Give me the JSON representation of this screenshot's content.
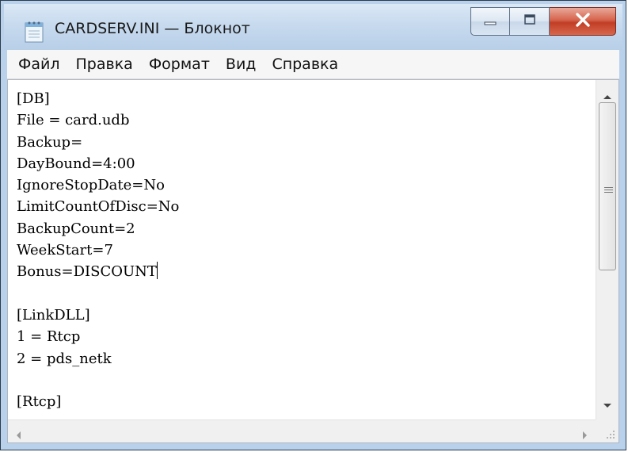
{
  "window": {
    "title": "CARDSERV.INI — Блокнот",
    "icon": "notepad-icon",
    "caption_buttons": [
      "minimize-icon",
      "maximize-icon",
      "close-icon"
    ]
  },
  "menu": {
    "items": [
      "Файл",
      "Правка",
      "Формат",
      "Вид",
      "Справка"
    ]
  },
  "document": {
    "lines": [
      "[DB]",
      "File = card.udb",
      "Backup=",
      "DayBound=4:00",
      "IgnoreStopDate=No",
      "LimitCountOfDisc=No",
      "BackupCount=2",
      "WeekStart=7",
      "Bonus=DISCOUNT",
      "",
      "[LinkDLL]",
      "1 = Rtcp",
      "2 = pds_netk",
      "",
      "[Rtcp]"
    ]
  }
}
